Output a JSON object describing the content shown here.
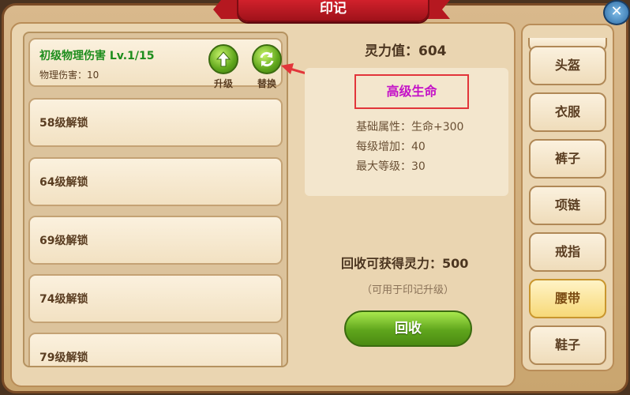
{
  "title": "印记",
  "close_icon": "close-icon",
  "slots": {
    "active": {
      "name": "初级物理伤害 Lv.1/15",
      "desc": "物理伤害：10",
      "upgrade_label": "升级",
      "replace_label": "替换",
      "upgrade_icon": "arrow-up-icon",
      "replace_icon": "refresh-icon"
    },
    "locked": [
      "58级解锁",
      "64级解锁",
      "69级解锁",
      "74级解锁",
      "79级解锁"
    ]
  },
  "detail": {
    "spirit_value": "灵力值：604",
    "item_name": "高级生命",
    "base_attr": "基础属性：生命+300",
    "per_level": "每级增加：40",
    "max_level": "最大等级：30",
    "recycle_gain": "回收可获得灵力：500",
    "recycle_note": "（可用于印记升级）",
    "recycle_button": "回收"
  },
  "tabs": [
    "头盔",
    "衣服",
    "裤子",
    "项链",
    "戒指",
    "腰带",
    "鞋子"
  ],
  "selected_tab": "腰带",
  "colors": {
    "banner": "#d8232e",
    "active_name": "#1d8d1c",
    "highlight_text": "#c412c8",
    "highlight_border": "#e2353a",
    "button_green": "#5fa51c"
  }
}
